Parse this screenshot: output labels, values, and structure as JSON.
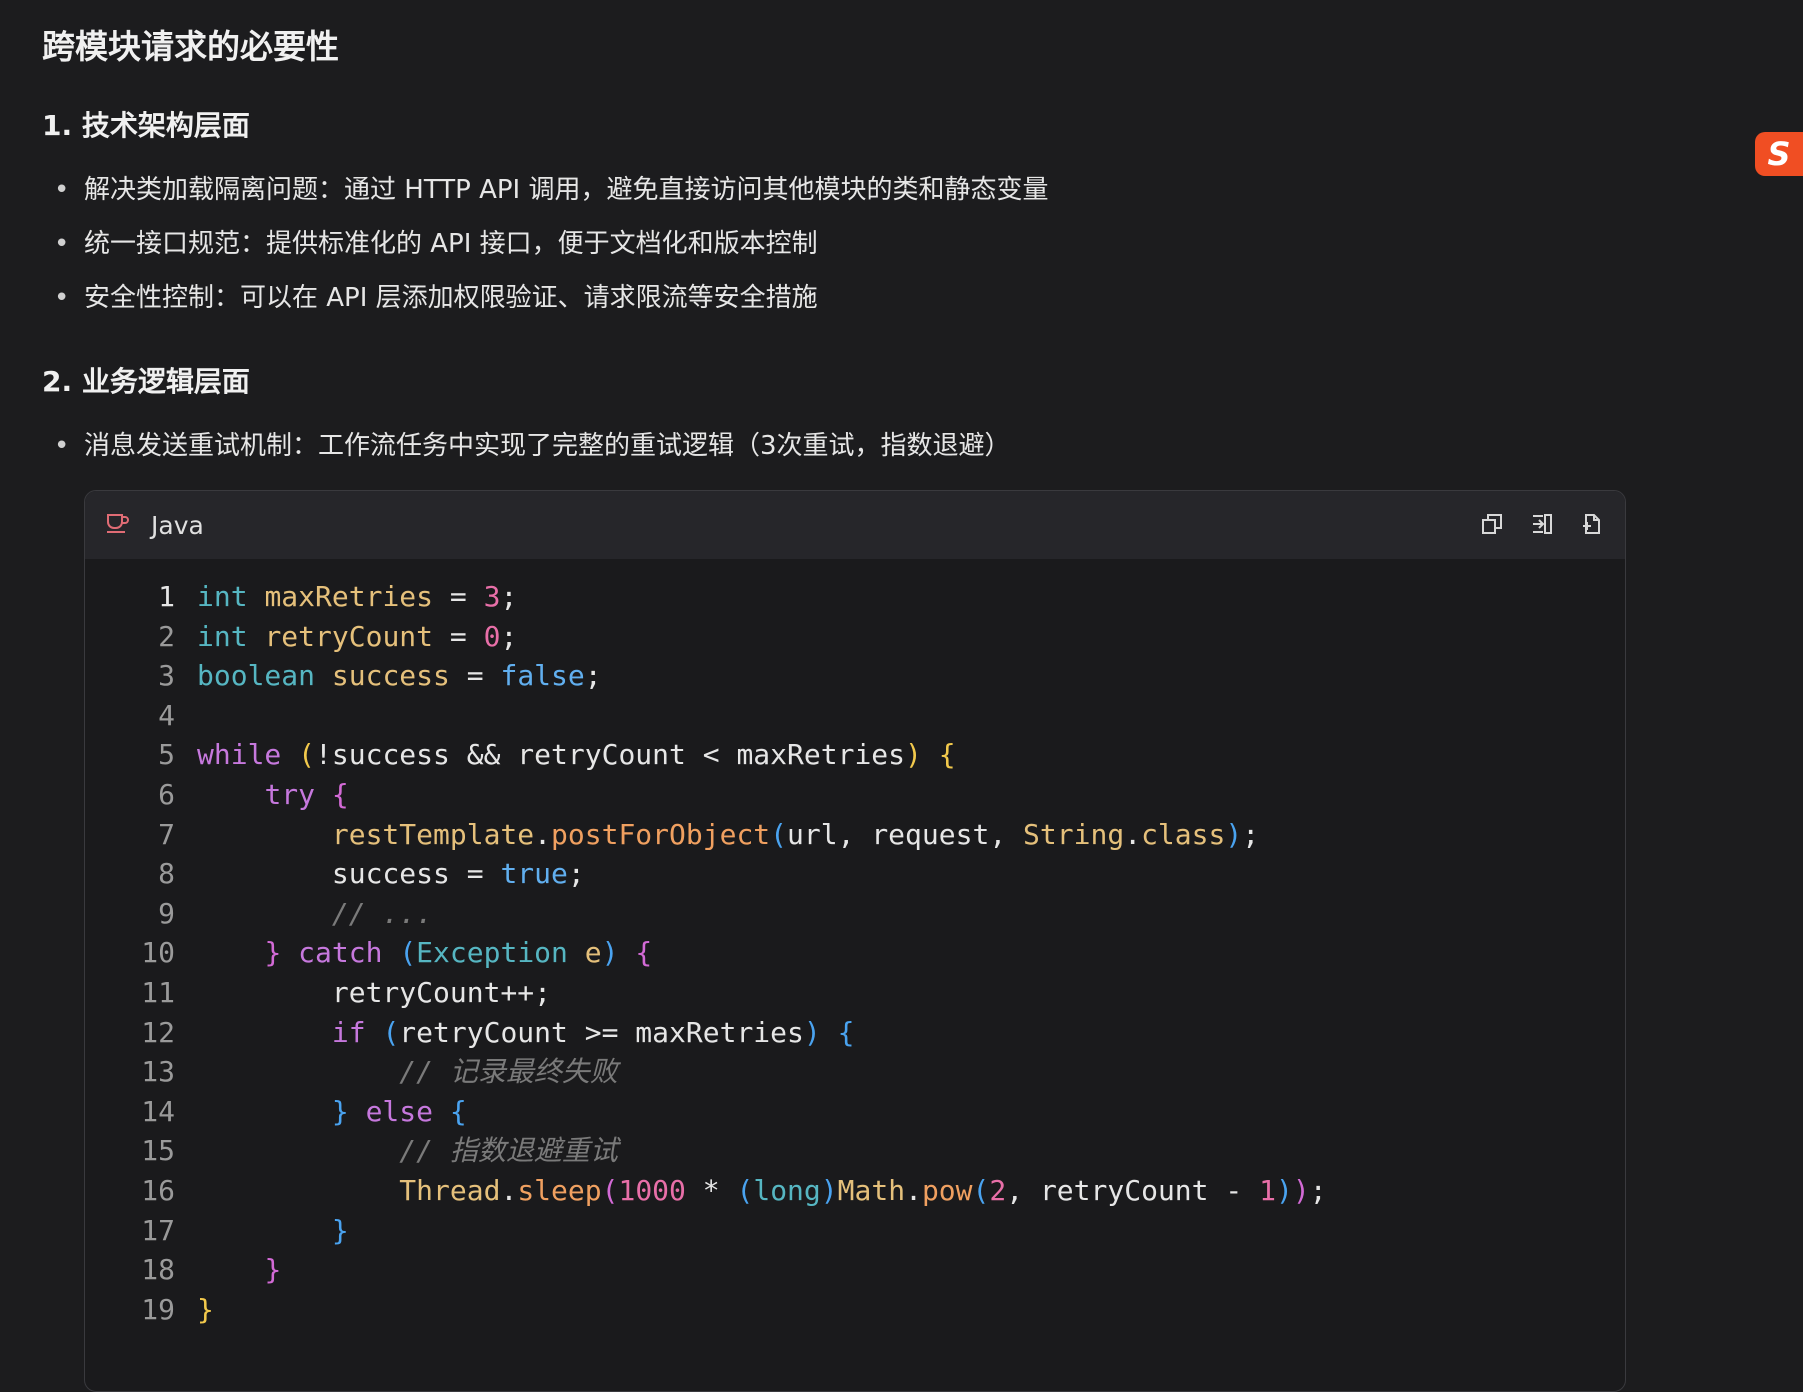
{
  "title": "跨模块请求的必要性",
  "sections": [
    {
      "heading": "1. 技术架构层面",
      "bullets": [
        "解决类加载隔离问题：通过 HTTP API 调用，避免直接访问其他模块的类和静态变量",
        "统一接口规范：提供标准化的 API 接口，便于文档化和版本控制",
        "安全性控制：可以在 API 层添加权限验证、请求限流等安全措施"
      ]
    },
    {
      "heading": "2. 业务逻辑层面",
      "bullets": [
        "消息发送重试机制：工作流任务中实现了完整的重试逻辑（3次重试，指数退避）"
      ]
    }
  ],
  "code_block": {
    "language": "Java",
    "icons": [
      "coffee-icon",
      "copy-icon",
      "insert-icon",
      "new-file-icon"
    ],
    "lines": [
      "int maxRetries = 3;",
      "int retryCount = 0;",
      "boolean success = false;",
      "",
      "while (!success && retryCount < maxRetries) {",
      "    try {",
      "        restTemplate.postForObject(url, request, String.class);",
      "        success = true;",
      "        // ...",
      "    } catch (Exception e) {",
      "        retryCount++;",
      "        if (retryCount >= maxRetries) {",
      "            // 记录最终失败",
      "        } else {",
      "            // 指数退避重试",
      "            Thread.sleep(1000 * (long)Math.pow(2, retryCount - 1));",
      "        }",
      "    }",
      "}"
    ],
    "line_numbers": [
      "1",
      "2",
      "3",
      "4",
      "5",
      "6",
      "7",
      "8",
      "9",
      "10",
      "11",
      "12",
      "13",
      "14",
      "15",
      "16",
      "17",
      "18",
      "19"
    ]
  },
  "ime_badge": "S"
}
